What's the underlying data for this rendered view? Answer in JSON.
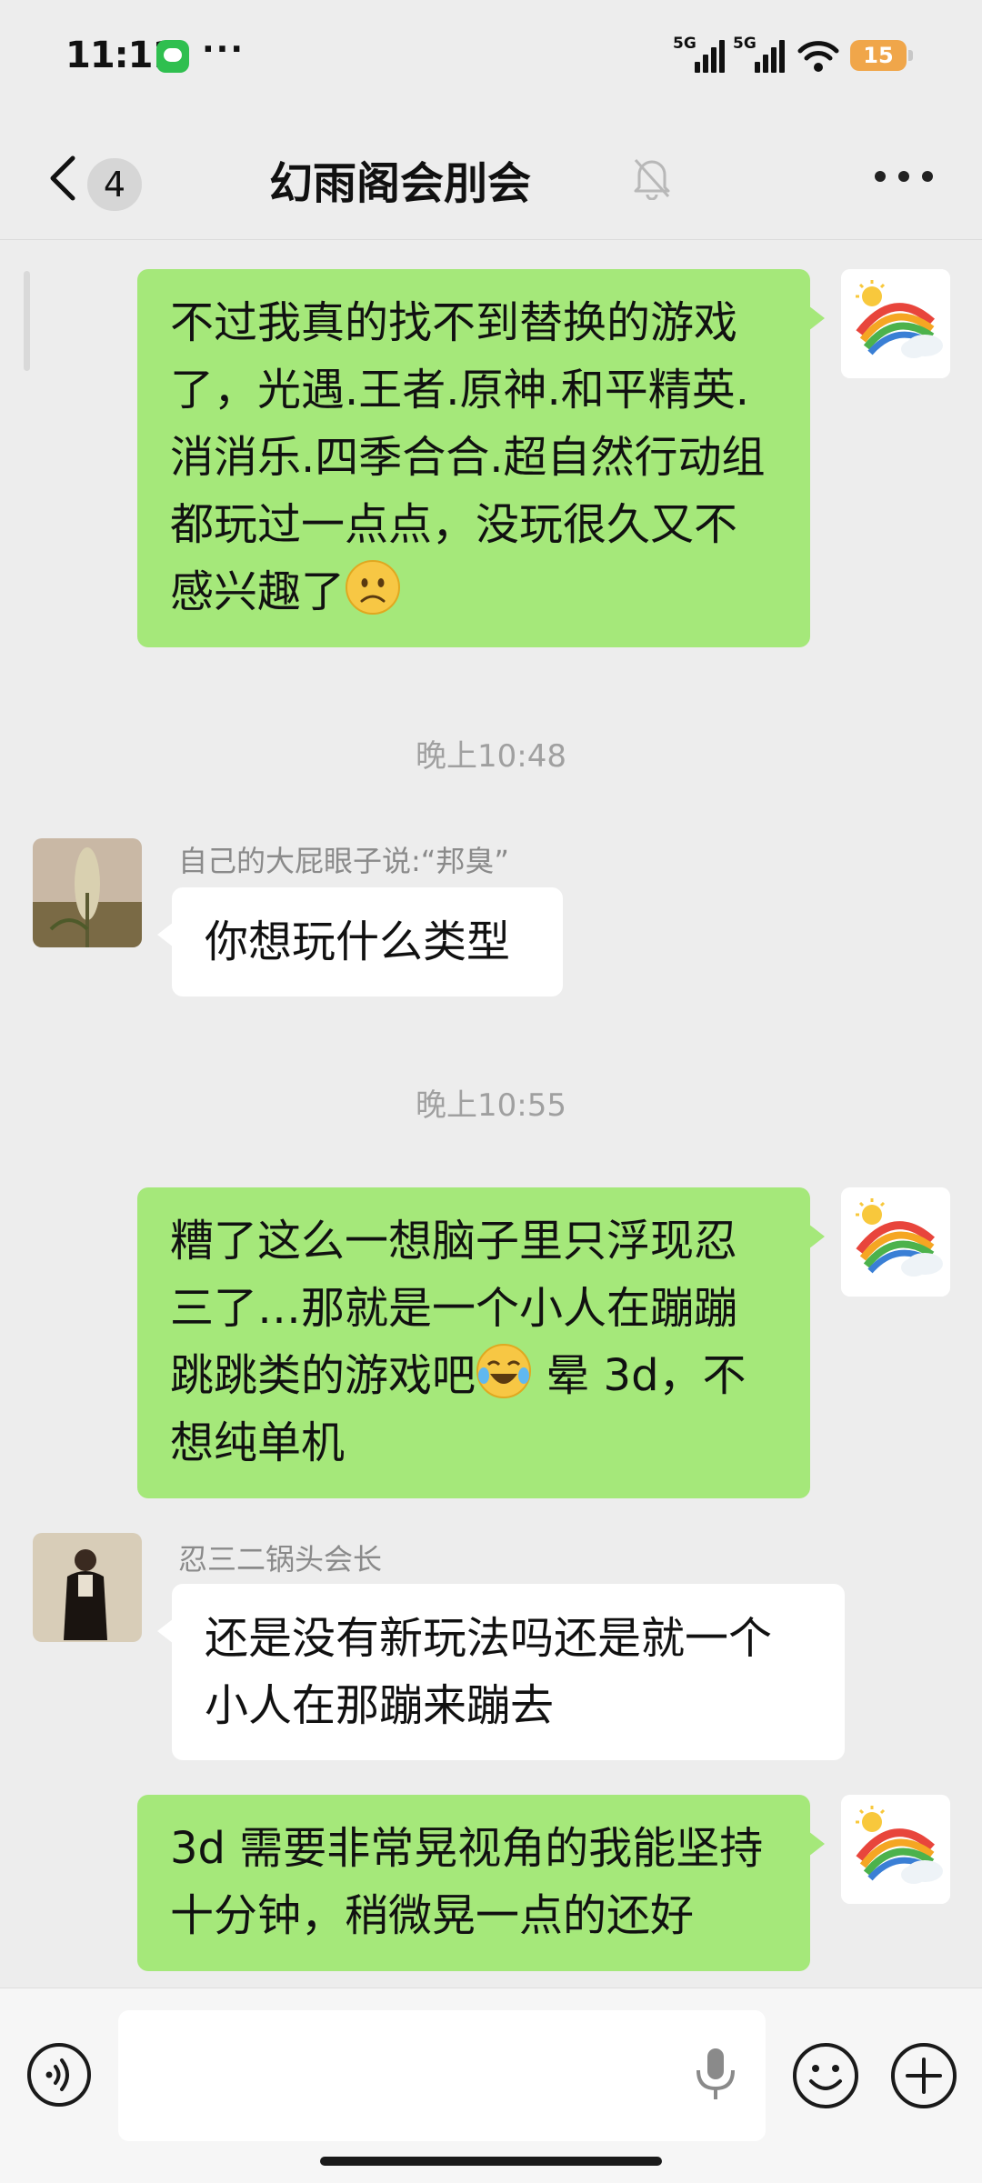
{
  "status_bar": {
    "time": "11:11",
    "signal_1": "5G",
    "signal_2": "5G",
    "battery": "15"
  },
  "nav": {
    "unread_count": "4",
    "title": "幻雨阁会刖会"
  },
  "messages": [
    {
      "side": "me",
      "lines": [
        "不过我真的找不到替换的游戏",
        "了，光遇.王者.原神.和平精英.",
        "消消乐.四季合合.超自然行动组",
        "都玩过一点点，没玩很久又不",
        "感兴趣了"
      ],
      "emoji": "frowning-face"
    },
    {
      "type": "time",
      "text": "晚上10:48"
    },
    {
      "side": "other",
      "sender": "自己的大屁眼子说:“邦臭”",
      "lines": [
        "你想玩什么类型"
      ]
    },
    {
      "type": "time",
      "text": "晚上10:55"
    },
    {
      "side": "me",
      "lines": [
        "糟了这么一想脑子里只浮现忍",
        "三了…那就是一个小人在蹦蹦",
        "跳跳类的游戏吧",
        " 晕 3d，不",
        "想纯单机"
      ],
      "emoji": "crying-laughing-face"
    },
    {
      "side": "other",
      "sender": "忍三二锅头会长",
      "lines": [
        "还是没有新玩法吗还是就一个",
        "小人在那蹦来蹦去"
      ]
    },
    {
      "side": "me",
      "lines": [
        "3d 需要非常晃视角的我能坚持",
        "十分钟，稍微晃一点的还好"
      ]
    }
  ],
  "input": {
    "placeholder": ""
  },
  "colors": {
    "my_bubble": "#a5e87a",
    "background": "#ededed",
    "battery": "#f0a64a"
  }
}
